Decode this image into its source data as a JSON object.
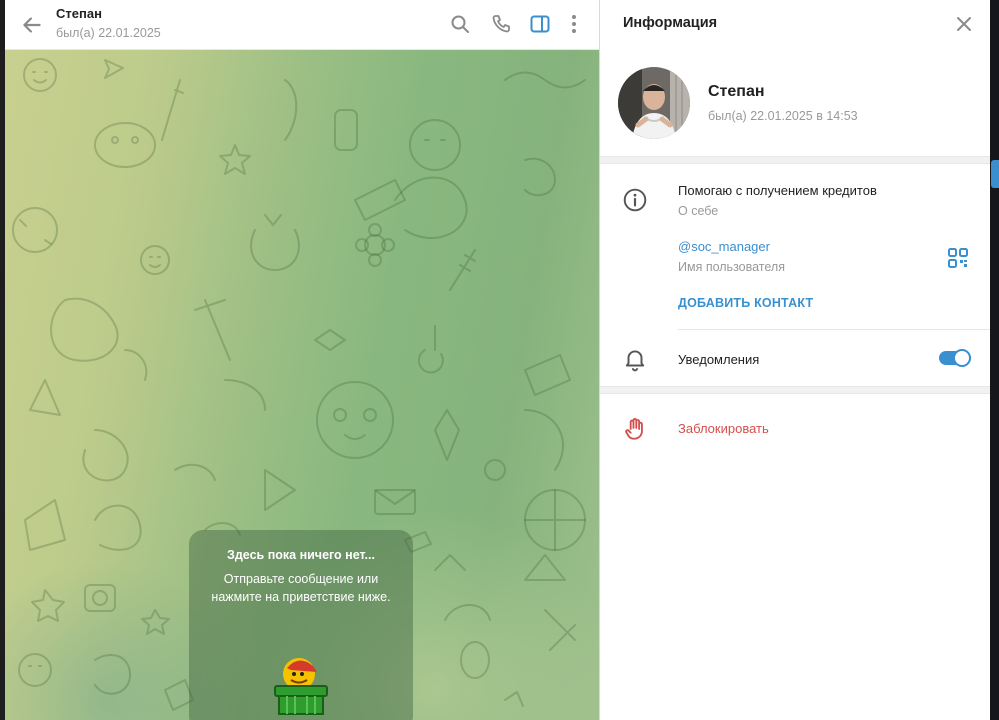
{
  "chat": {
    "title": "Степан",
    "status": "был(а) 22.01.2025",
    "empty_title": "Здесь пока ничего нет...",
    "empty_text": "Отправьте сообщение или нажмите на приветствие ниже."
  },
  "info": {
    "title": "Информация",
    "name": "Степан",
    "status": "был(а) 22.01.2025 в 14:53",
    "bio": "Помогаю с получением кредитов",
    "bio_label": "О себе",
    "username": "@soc_manager",
    "username_label": "Имя пользователя",
    "add_contact": "ДОБАВИТЬ КОНТАКТ",
    "notifications": "Уведомления",
    "notifications_on": true,
    "block": "Заблокировать"
  },
  "colors": {
    "accent": "#3a8fcf",
    "danger": "#d4504f",
    "muted": "#999999"
  },
  "icons": {
    "back": "arrow-left-icon",
    "search": "search-icon",
    "call": "phone-icon",
    "panel": "sidebar-toggle-icon",
    "menu": "more-vertical-icon",
    "close": "close-icon",
    "info": "info-icon",
    "qr": "qr-code-icon",
    "bell": "bell-icon",
    "block": "hand-stop-icon"
  }
}
